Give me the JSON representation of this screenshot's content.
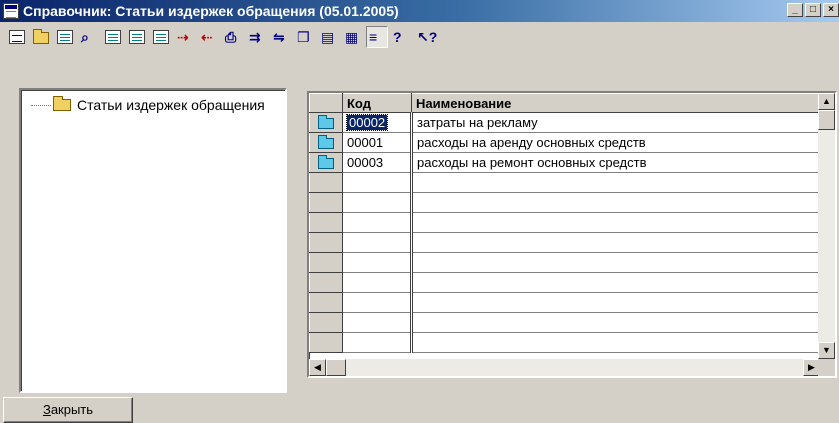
{
  "window": {
    "title": "Справочник: Статьи издержек обращения (05.01.2005)",
    "controls": [
      "_",
      "□",
      "×"
    ]
  },
  "toolbar": {
    "buttons": [
      {
        "icon": "new-item-icon",
        "glyph": ""
      },
      {
        "icon": "new-folder-icon",
        "glyph": ""
      },
      {
        "icon": "edit-icon",
        "glyph": ""
      },
      {
        "icon": "find-icon",
        "glyph": "⌕"
      },
      {
        "icon": "grid-add-icon",
        "glyph": ""
      },
      {
        "icon": "grid-delete-icon",
        "glyph": ""
      },
      {
        "icon": "grid-copy-icon",
        "glyph": ""
      },
      {
        "icon": "move-right-icon",
        "glyph": "⇢"
      },
      {
        "icon": "move-left-icon",
        "glyph": "⇠"
      },
      {
        "icon": "print-icon",
        "glyph": "⎙"
      },
      {
        "icon": "export-icon",
        "glyph": "⇉"
      },
      {
        "icon": "import-icon",
        "glyph": "⇋"
      },
      {
        "icon": "copy-icon",
        "glyph": "❐"
      },
      {
        "icon": "properties-icon",
        "glyph": "▤"
      },
      {
        "icon": "report-icon",
        "glyph": "▦"
      },
      {
        "icon": "tree-view-icon",
        "glyph": "≡"
      },
      {
        "icon": "help-icon",
        "glyph": "?"
      },
      {
        "icon": "context-help-icon",
        "glyph": "↖?"
      }
    ]
  },
  "tree": {
    "root_label": "Статьи издержек обращения"
  },
  "grid": {
    "columns": [
      "Код",
      "Наименование"
    ],
    "rows": [
      {
        "code": "00002",
        "name": "затраты на рекламу"
      },
      {
        "code": "00001",
        "name": "расходы на аренду основных средств"
      },
      {
        "code": "00003",
        "name": "расходы на ремонт основных средств"
      }
    ],
    "selected_row": 0
  },
  "footer": {
    "close_underline": "З",
    "close_rest": "акрыть"
  },
  "colors": {
    "title_gradient_start": "#0a246a",
    "title_gradient_end": "#a6caf0",
    "face": "#d4d0c8"
  }
}
